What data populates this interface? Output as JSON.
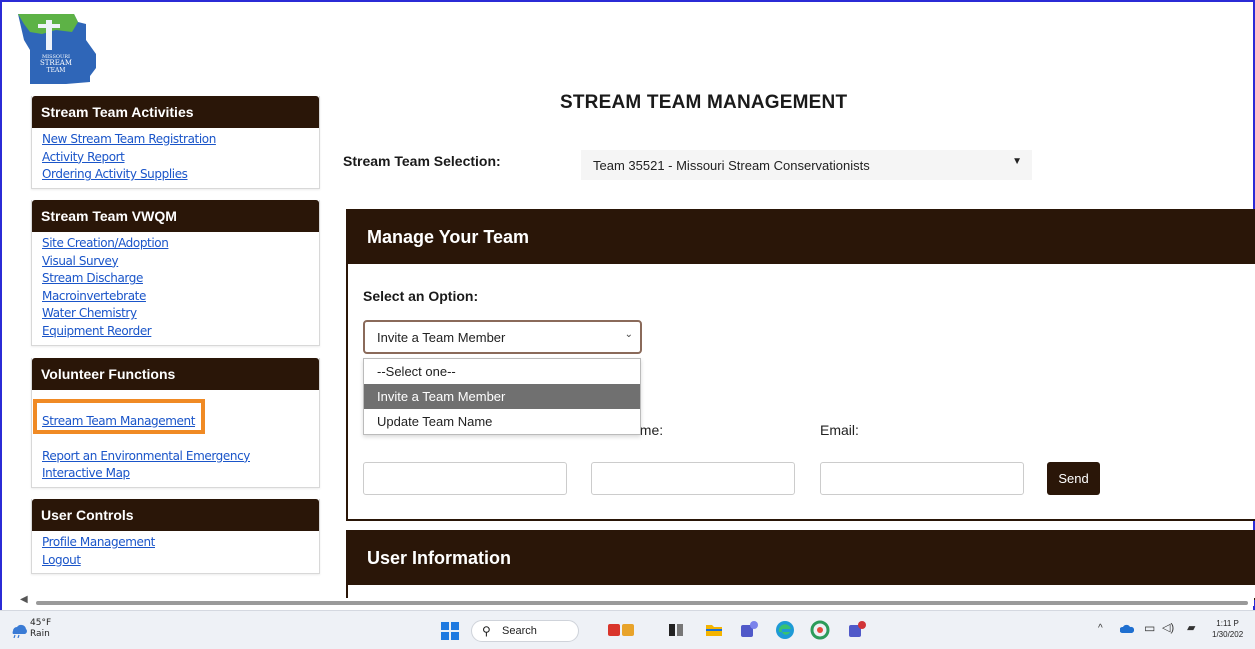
{
  "logo": {
    "text_lines": [
      "MISSOURI",
      "STREAM",
      "TEAM"
    ]
  },
  "sidebar": {
    "activities": {
      "title": "Stream Team Activities",
      "links": [
        "New Stream Team Registration",
        "Activity Report",
        "Ordering Activity Supplies"
      ]
    },
    "vwqm": {
      "title": "Stream Team VWQM",
      "links": [
        "Site Creation/Adoption",
        "Visual Survey",
        "Stream Discharge",
        "Macroinvertebrate",
        "Water Chemistry",
        "Equipment Reorder"
      ]
    },
    "volunteer": {
      "title": "Volunteer Functions",
      "links": [
        "Stream Team Management",
        "Report an Environmental Emergency",
        "Interactive Map"
      ]
    },
    "user_controls": {
      "title": "User Controls",
      "links": [
        "Profile Management",
        "Logout"
      ]
    }
  },
  "main": {
    "page_title": "STREAM TEAM MANAGEMENT",
    "selection_label": "Stream Team Selection:",
    "selected_team": "Team 35521 - Missouri Stream Conservationists",
    "manage_panel": {
      "title": "Manage Your Team",
      "option_label": "Select an Option:",
      "option_value": "Invite a Team Member",
      "options": [
        "--Select one--",
        "Invite a Team Member",
        "Update Team Name"
      ],
      "email_label": "Email:",
      "name_label_fragment": "ame:",
      "send_label": "Send"
    },
    "user_panel": {
      "title": "User Information"
    }
  },
  "taskbar": {
    "weather_temp": "45°F",
    "weather_desc": "Rain",
    "search_placeholder": "Search",
    "time": "1:11 P",
    "date": "1/30/202"
  },
  "colors": {
    "header_brown": "#2a1608",
    "link_blue": "#1a55c9",
    "highlight_orange": "#f08a24"
  }
}
